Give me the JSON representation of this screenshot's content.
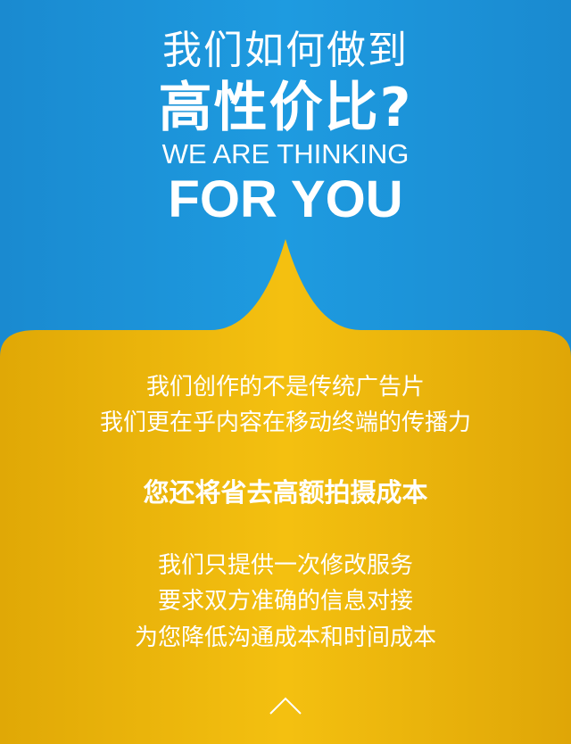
{
  "hero": {
    "line1": "我们如何做到",
    "line2": "高性价比?",
    "line3": "WE ARE THINKING",
    "line4": "FOR YOU"
  },
  "content": {
    "para1": [
      "我们创作的不是传统广告片",
      "我们更在乎内容在移动终端的传播力"
    ],
    "emphasis": "您还将省去高额拍摄成本",
    "para2": [
      "我们只提供一次修改服务",
      "要求双方准确的信息对接",
      "为您降低沟通成本和时间成本"
    ]
  },
  "icons": {
    "scroll": "chevron-up-icon"
  },
  "colors": {
    "blue_top": "#1e9be0",
    "blue_edge": "#1a8ad0",
    "gold": "#e9b208",
    "gold_light": "#f6c412",
    "text": "#ffffff"
  }
}
